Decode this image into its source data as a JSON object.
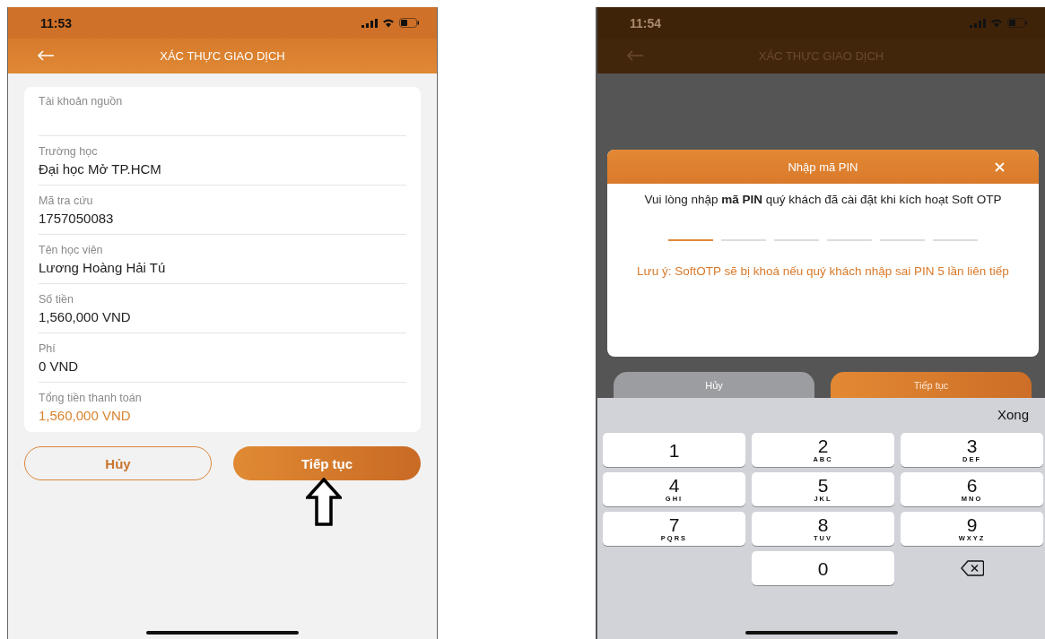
{
  "left_screen": {
    "status_bar": {
      "time": "11:53"
    },
    "header": {
      "title": "XÁC THỰC GIAO DỊCH"
    },
    "fields": [
      {
        "label": "Tài khoản nguồn",
        "kind": "plain"
      },
      {
        "label": "Trường học",
        "value": "Đại học Mở TP.HCM",
        "kind": "plain"
      },
      {
        "label": "Mã tra cứu",
        "value": "1757050083",
        "kind": "plain"
      },
      {
        "label": "Tên học viên",
        "value": "Lương Hoàng Hải Tú",
        "kind": "plain"
      },
      {
        "label": "Số tiền",
        "value": "1,560,000 VND",
        "kind": "plain"
      },
      {
        "label": "Phí",
        "value": "0 VND",
        "kind": "plain"
      },
      {
        "label": "Tổng tiền thanh toán",
        "value": "1,560,000 VND",
        "kind": "total"
      }
    ],
    "buttons": [
      {
        "label": "Hủy",
        "kind": "outline"
      },
      {
        "label": "Tiếp tục",
        "kind": "filled"
      }
    ]
  },
  "right_screen": {
    "status_bar": {
      "time": "11:54"
    },
    "header": {
      "title": "XÁC THỰC GIAO DỊCH"
    },
    "dialog": {
      "title": "Nhập mã PIN",
      "message": "Vui lòng nhập **mã PIN** quý khách đã cài đặt khi kích hoạt Soft OTP",
      "pin_slots": [
        {
          "focused": true
        },
        {
          "focused": false
        },
        {
          "focused": false
        },
        {
          "focused": false
        },
        {
          "focused": false
        },
        {
          "focused": false
        }
      ],
      "warning": "Lưu ý: SoftOTP sẽ bị khoá nếu quý khách nhập sai PIN 5 lần liên tiếp"
    },
    "buttons": [
      {
        "label": "Hủy",
        "kind": "muted"
      },
      {
        "label": "Tiếp tục",
        "kind": "filled"
      }
    ],
    "keyboard": {
      "done": "Xong",
      "keys": [
        {
          "kind": "digit",
          "digit": "1"
        },
        {
          "kind": "digit",
          "digit": "2",
          "letters": "ABC"
        },
        {
          "kind": "digit",
          "digit": "3",
          "letters": "DEF"
        },
        {
          "kind": "digit",
          "digit": "4",
          "letters": "GHI"
        },
        {
          "kind": "digit",
          "digit": "5",
          "letters": "JKL"
        },
        {
          "kind": "digit",
          "digit": "6",
          "letters": "MNO"
        },
        {
          "kind": "digit",
          "digit": "7",
          "letters": "PQRS"
        },
        {
          "kind": "digit",
          "digit": "8",
          "letters": "TUV"
        },
        {
          "kind": "digit",
          "digit": "9",
          "letters": "WXYZ"
        },
        {
          "kind": "digit",
          "digit": "0"
        },
        {
          "kind": "backspace"
        }
      ]
    }
  }
}
